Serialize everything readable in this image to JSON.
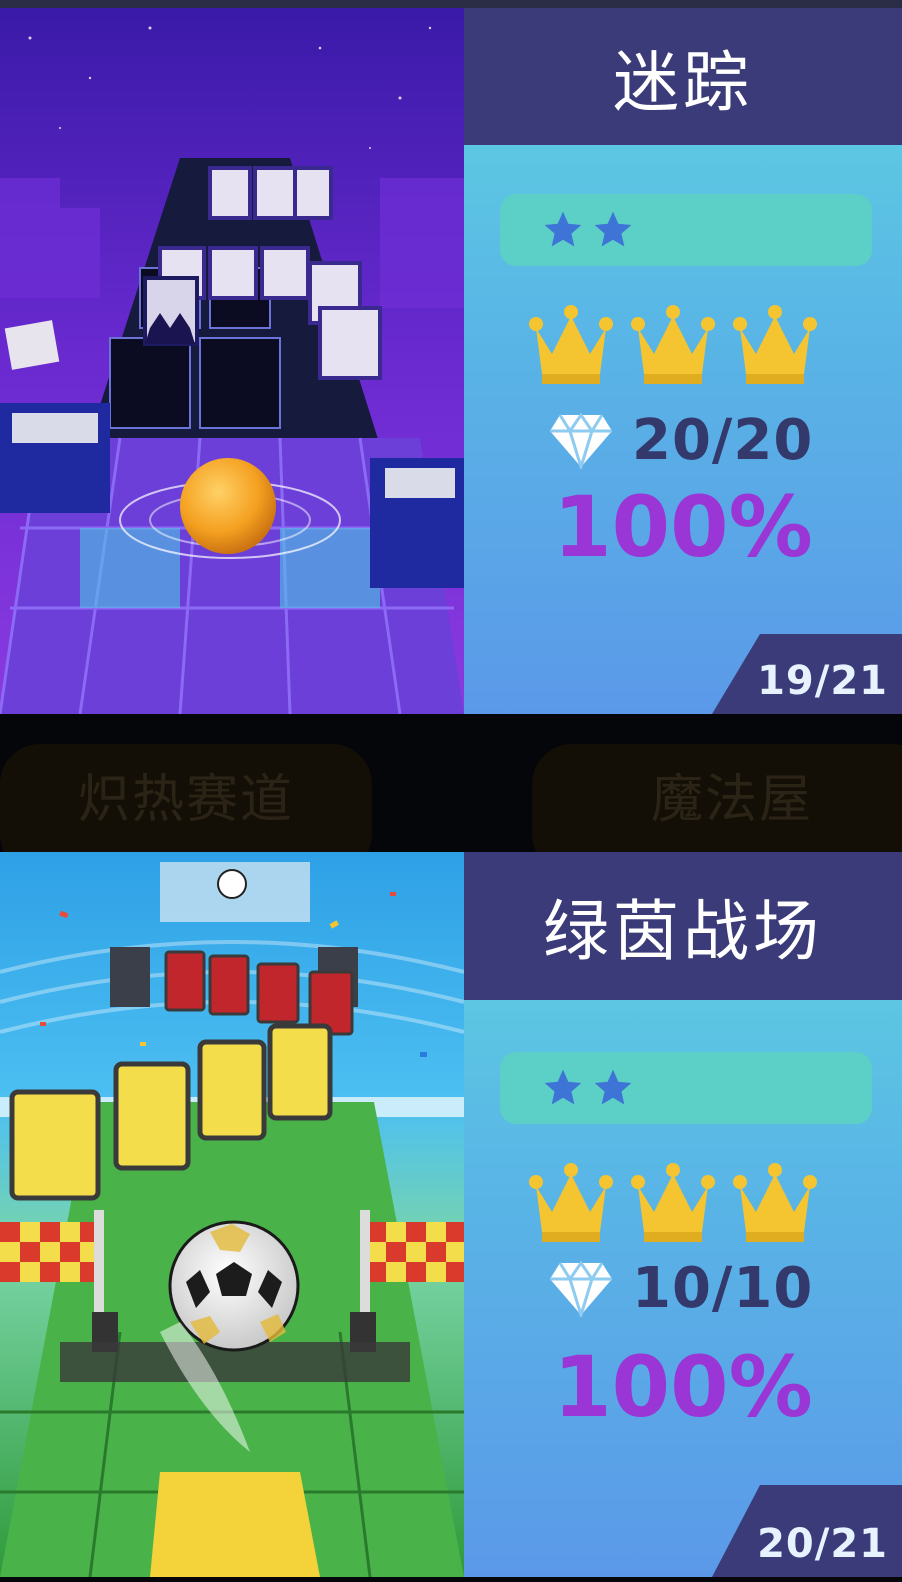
{
  "levels": [
    {
      "title": "迷踪",
      "difficulty_stars": 2,
      "crowns": 3,
      "gems": "20/20",
      "progress_percent": "100%",
      "page": "19/21"
    },
    {
      "title": "绿茵战场",
      "difficulty_stars": 2,
      "crowns": 3,
      "gems": "10/10",
      "progress_percent": "100%",
      "page": "20/21"
    }
  ],
  "faded_tabs": {
    "left": "炽热赛道",
    "right": "魔法屋"
  },
  "colors": {
    "title_bar": "#3a3b78",
    "difficulty_bar": "#5ccfc6",
    "star": "#3e74d6",
    "crown": "#f4c531",
    "percent": "#9a35d6",
    "gem_count": "#34396b"
  }
}
